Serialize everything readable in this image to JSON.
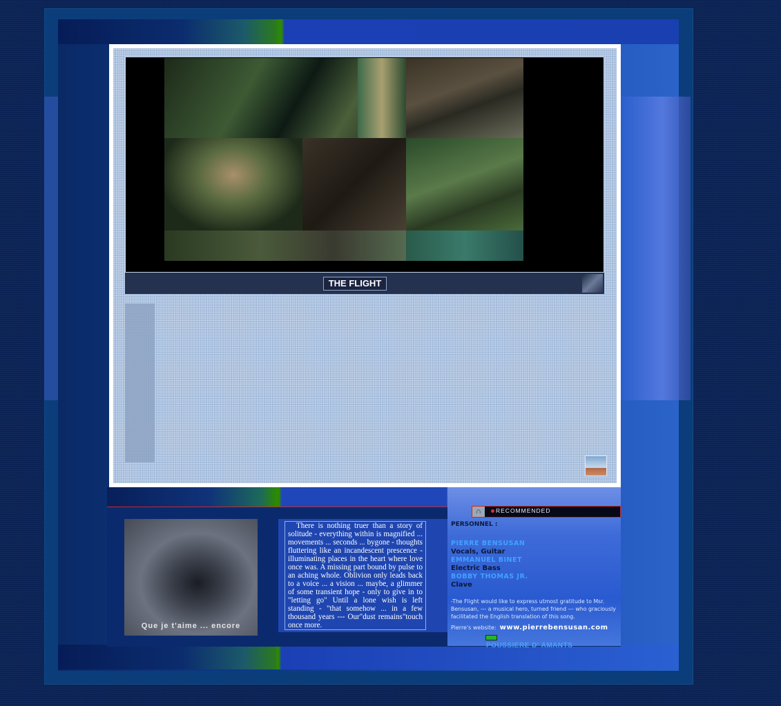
{
  "hero": {
    "title": "THE FLIGHT"
  },
  "album": {
    "caption": "Que je t'aime ... encore"
  },
  "poem": {
    "text": "There is nothing truer than a story of solitude - everything within is magnified ... movements ... seconds ... bygone - thoughts fluttering like an incandescent prescence - illuminating places in the heart where love once was. A missing part bound by pulse to an aching whole. Oblivion only leads back to a voice ... a vision ... maybe, a glimmer of some transient hope - only to give in to \"letting go\" Until a lone wish is left standing - \"that somehow ... in a few thousand years --- Our\"dust remains\"touch once more."
  },
  "recommended": {
    "label": "RECOMMENDED",
    "icon": "headphones-icon"
  },
  "credits": {
    "heading": "PERSONNEL :",
    "people": [
      {
        "name": "PIERRE BENSUSAN",
        "role": "Vocals, Guitar"
      },
      {
        "name": "EMMANUEL BINET",
        "role": "Electric Bass"
      },
      {
        "name": "BOBBY THOMAS JR.",
        "role": "Clave"
      }
    ],
    "note": "-The Flight would like to express utmost gratitude to Msr. Bensusan, --- a musical hero, turned friend --- who graciously facilitated the English translation of this song.",
    "website_label": "Pierre's website:",
    "website_url": "www.pierrebensusan.com"
  },
  "song": {
    "title": "POUSSIERE D' AMANTS"
  }
}
